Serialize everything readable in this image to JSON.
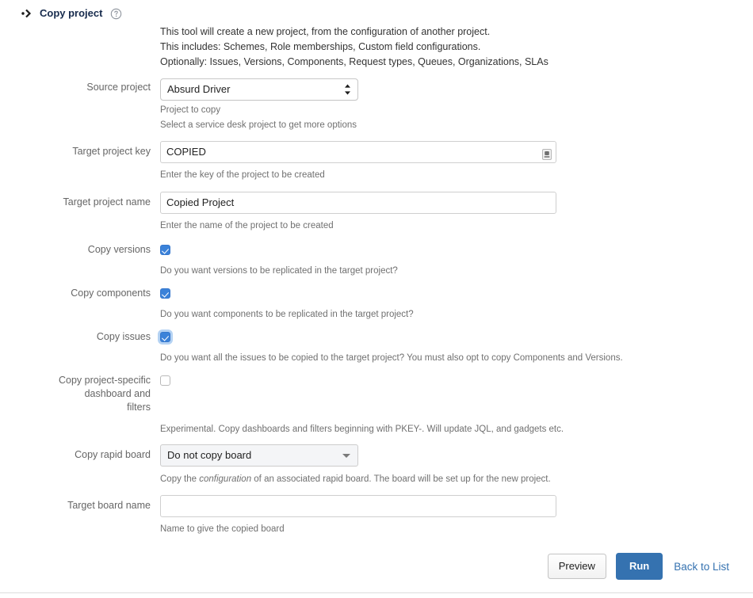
{
  "header": {
    "twisty_icon": "bullet-right-arrow-icon",
    "title": "Copy project",
    "help_icon": "help-circle-icon",
    "description_lines": [
      "This tool will create a new project, from the configuration of another project.",
      "This includes: Schemes, Role memberships, Custom field configurations.",
      "Optionally: Issues, Versions, Components, Request types, Queues, Organizations, SLAs"
    ]
  },
  "fields": {
    "source_project": {
      "label": "Source project",
      "value": "Absurd Driver",
      "desc_line1": "Project to copy",
      "desc_line2": "Select a service desk project to get more options",
      "spinner_icon": "up-down-spinner-icon"
    },
    "target_project_key": {
      "label": "Target project key",
      "value": "COPIED",
      "placeholder": "",
      "desc": "Enter the key of the project to be created",
      "autofill_icon": "autofill-badge-icon"
    },
    "target_project_name": {
      "label": "Target project name",
      "value": "Copied Project",
      "placeholder": "",
      "desc": "Enter the name of the project to be created"
    },
    "copy_versions": {
      "label": "Copy versions",
      "checked": true,
      "desc": "Do you want versions to be replicated in the target project?"
    },
    "copy_components": {
      "label": "Copy components",
      "checked": true,
      "desc": "Do you want components to be replicated in the target project?"
    },
    "copy_issues": {
      "label": "Copy issues",
      "checked": true,
      "focused": true,
      "desc": "Do you want all the issues to be copied to the target project? You must also opt to copy Components and Versions."
    },
    "copy_dashboard_filters": {
      "label_line1": "Copy project-specific",
      "label_line2": "dashboard and",
      "label_line3": "filters",
      "checked": false,
      "desc_before_italic": "Experimental. Copy dashboards and filters beginning with PKEY-. Will update JQL, and gadgets etc."
    },
    "copy_rapid_board": {
      "label": "Copy rapid board",
      "value": "Do not copy board",
      "caret_icon": "chevron-down-icon",
      "desc_part1": "Copy the ",
      "desc_italic": "configuration",
      "desc_part2": " of an associated rapid board. The board will be set up for the new project."
    },
    "target_board_name": {
      "label": "Target board name",
      "value": "",
      "placeholder": "",
      "desc": "Name to give the copied board"
    }
  },
  "actions": {
    "preview_label": "Preview",
    "run_label": "Run",
    "back_label": "Back to List"
  },
  "colors": {
    "primary_blue": "#3572b0",
    "checkbox_blue": "#3b82d9",
    "link_blue": "#3572b0",
    "label_gray": "#666666",
    "desc_gray": "#707070"
  }
}
